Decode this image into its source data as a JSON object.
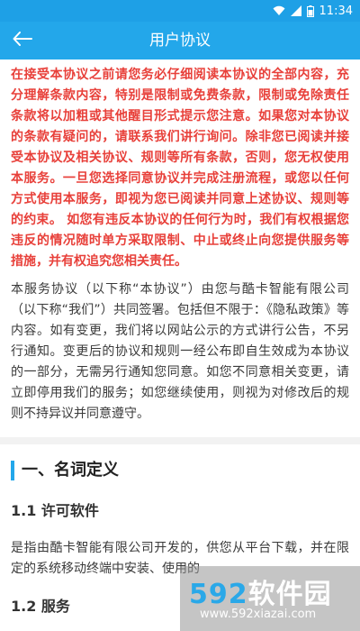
{
  "status_bar": {
    "time": "11:34",
    "icons": [
      "wifi-icon",
      "signal-icon",
      "battery-icon"
    ],
    "color": "#1ea0e6"
  },
  "app_bar": {
    "title": "用户协议",
    "back_icon": "arrow-left-icon",
    "color": "#23a7ea"
  },
  "agreement": {
    "warning": "在接受本协议之前请您务必仔细阅读本协议的全部内容，充分理解条款内容，特别是限制或免费条款，限制或免除责任条款将以加粗或其他醒目形式提示您注意。如果您对本协议的条款有疑问的，请联系我们讲行询问。除非您已阅读并接受本协议及相关协议、规则等所有条款，否则，您无权使用本服务。一旦您选择同意协议并完成注册流程，或您以任何方式使用本服务，即视为您已阅读并同意上述协议、规则等的约束。 如您有违反本协议的任何行为时，我们有权根据您违反的情况随时单方采取限制、中止或终止向您提供服务等措施，并有权追究您相关责任。",
    "warning_color": "#e8403a",
    "intro": "本服务协议（以下称“本协议”）由您与酷卡智能有限公司（以下称“我们”）共同签署。包括但不限于：《隐私政策》等内容。如有变更，我们将以网站公示的方式讲行公告，不另行通知。变更后的协议和规则一经公布即自生效成为本协议的一部分，无需另行通知您同意。如您不同意相关变更，请立即停用我们的服务；如您继续使用，则视为对修改后的规则不持异议并同意遵守。",
    "section1_title": "一、名词定义",
    "sub1_title": "1.1 许可软件",
    "sub1_text": "是指由酷卡智能有限公司开发的，供您从平台下载，并在限定的系统移动终端中安装、使用的",
    "sub2_title": "1.2 服务"
  },
  "watermark": {
    "logo_number": "592",
    "logo_text": "软件园",
    "url": "www.592xiazai.com"
  }
}
